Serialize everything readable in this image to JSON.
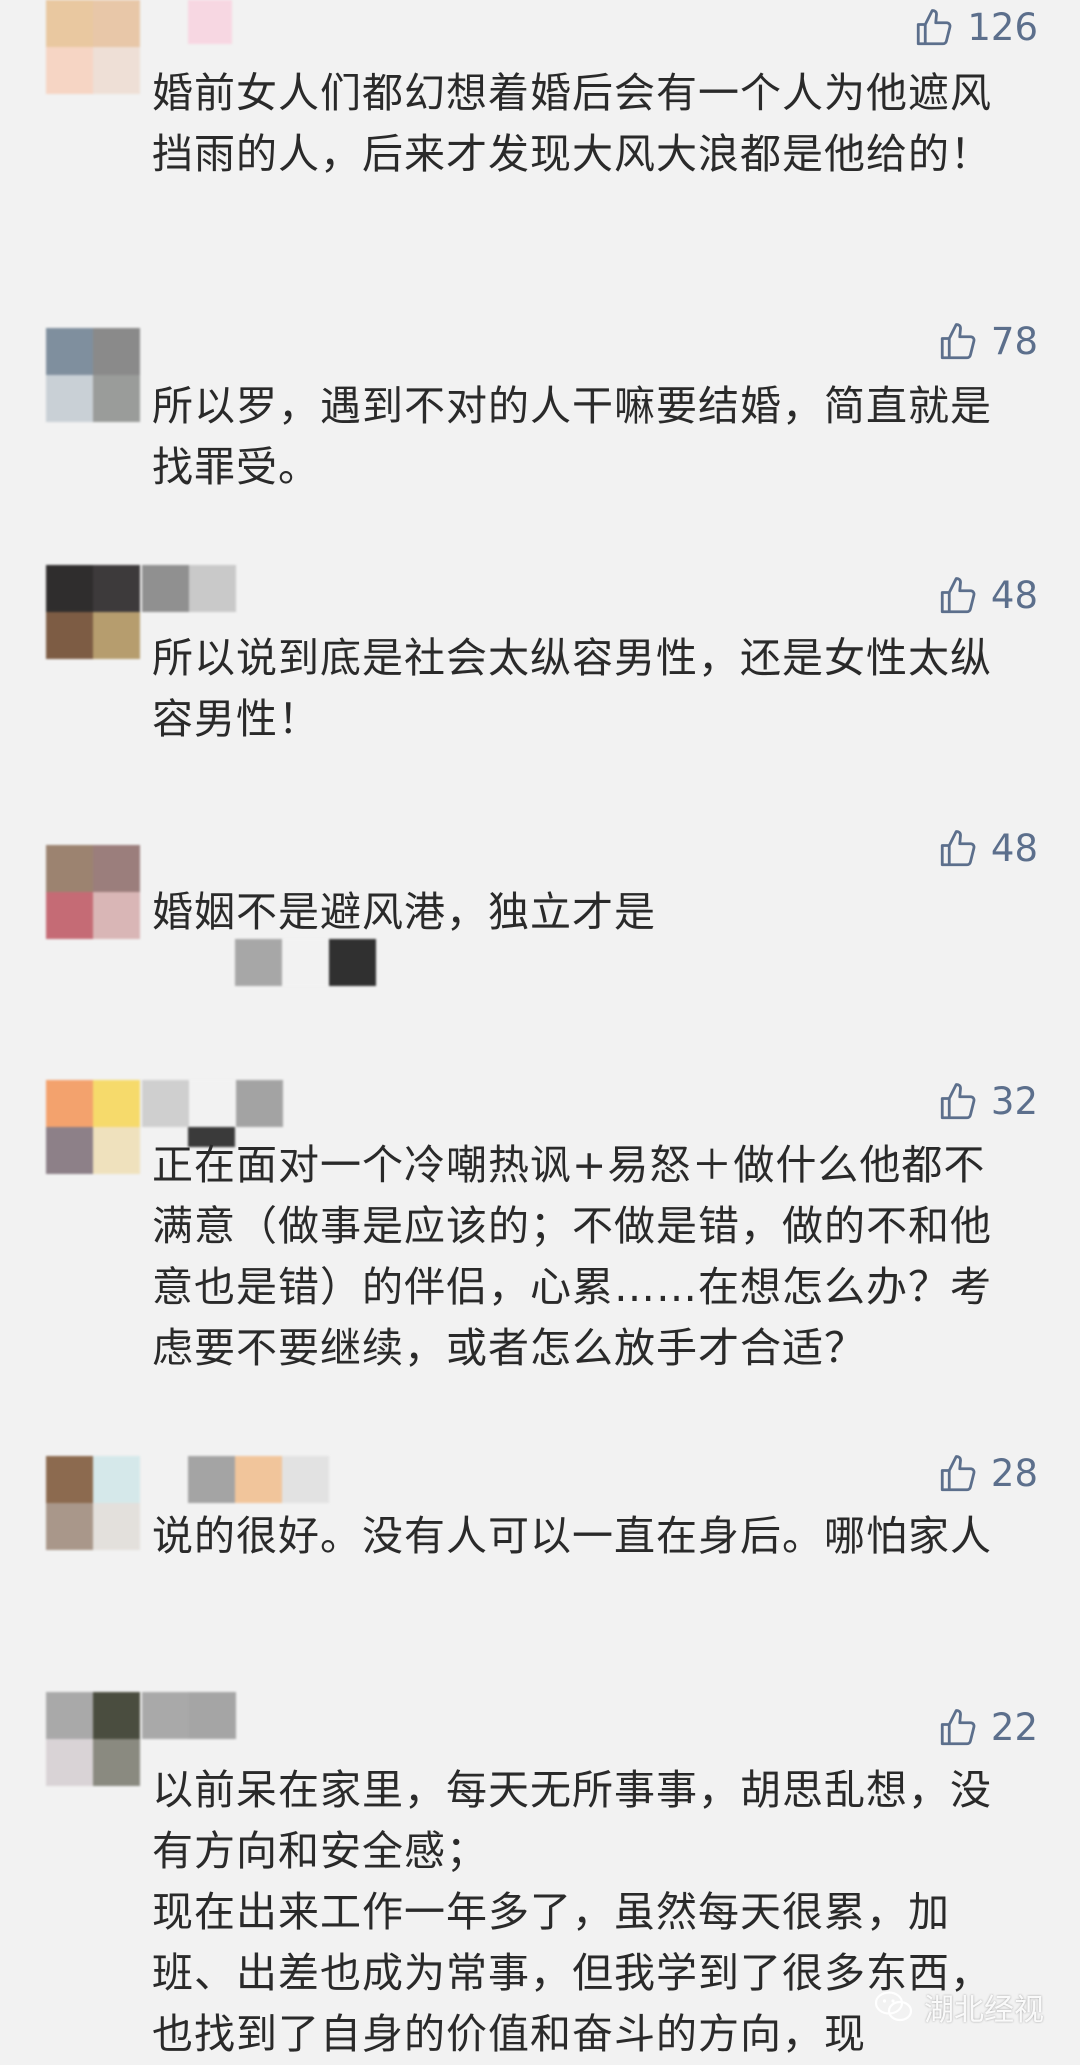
{
  "comments": [
    {
      "likes": "126",
      "text": "婚前女人们都幻想着婚后会有一个人为他遮风挡雨的人，后来才发现大风大浪都是他给的！"
    },
    {
      "likes": "78",
      "text": "所以罗，遇到不对的人干嘛要结婚，简直就是找罪受。"
    },
    {
      "likes": "48",
      "text": "所以说到底是社会太纵容男性，还是女性太纵容男性！"
    },
    {
      "likes": "48",
      "text": "婚姻不是避风港，独立才是"
    },
    {
      "likes": "32",
      "text": "正在面对一个冷嘲热讽+易怒＋做什么他都不满意（做事是应该的；不做是错，做的不和他意也是错）的伴侣，心累……在想怎么办？考虑要不要继续，或者怎么放手才合适？"
    },
    {
      "likes": "28",
      "text": "说的很好。没有人可以一直在身后。哪怕家人"
    },
    {
      "likes": "22",
      "text": "以前呆在家里，每天无所事事，胡思乱想，没有方向和安全感；\n现在出来工作一年多了，虽然每天很累，加班、出差也成为常事，但我学到了很多东西，也找到了自身的价值和奋斗的方向，现"
    }
  ],
  "watermark": {
    "text": "湖北经视",
    "icon": "wechat-icon"
  },
  "colors": {
    "background": "#f2f2f2",
    "like_color": "#5c6f8c",
    "text_color": "#2a2a2a"
  }
}
